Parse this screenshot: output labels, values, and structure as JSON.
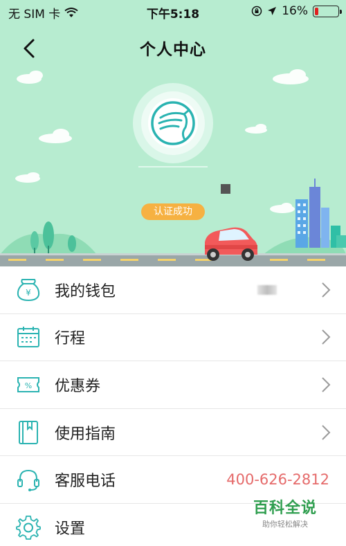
{
  "status": {
    "carrier": "无 SIM 卡",
    "time": "下午5:18",
    "battery": "16%",
    "battery_level": 0.16,
    "icons": [
      "wifi-icon",
      "orientation-lock-icon",
      "location-arrow-icon",
      "battery-icon"
    ]
  },
  "header": {
    "title": "个人中心",
    "back_icon": "back-chevron-icon"
  },
  "profile": {
    "logo_icon": "horse-logo-icon",
    "verification_badge": "认证成功"
  },
  "menu": [
    {
      "label": "我的钱包",
      "icon": "wallet-icon",
      "value": ""
    },
    {
      "label": "行程",
      "icon": "calendar-icon",
      "value": ""
    },
    {
      "label": "优惠券",
      "icon": "coupon-icon",
      "value": ""
    },
    {
      "label": "使用指南",
      "icon": "guide-book-icon",
      "value": ""
    },
    {
      "label": "客服电话",
      "icon": "headset-icon",
      "value": "400-626-2812"
    },
    {
      "label": "设置",
      "icon": "gear-icon",
      "value": ""
    }
  ],
  "watermark": {
    "title": "百科全说",
    "subtitle": "助你轻松解决"
  },
  "colors": {
    "hero_bg": "#b7ecd0",
    "accent_teal": "#2ab3b1",
    "badge": "#f6b142",
    "phone_text": "#e56a6a"
  }
}
